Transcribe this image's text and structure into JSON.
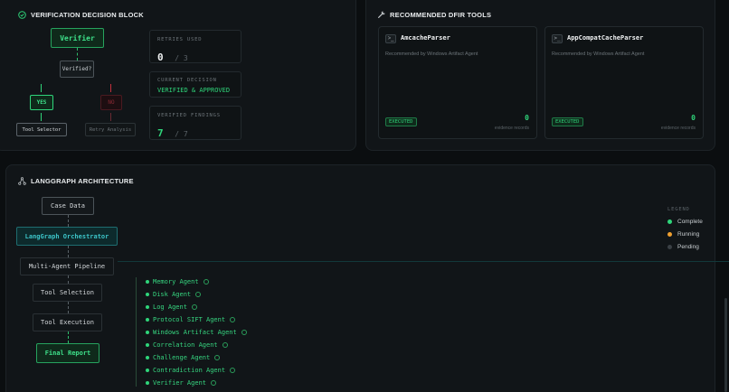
{
  "verification": {
    "title": "VERIFICATION DECISION BLOCK",
    "icon": "check-circle-icon",
    "flow": {
      "verifier": "Verifier",
      "question": "Verified?",
      "yes": "YES",
      "no": "NO",
      "yes_target": "Tool Selector",
      "no_target": "Retry Analysis"
    },
    "stats": {
      "retries_label": "RETRIES USED",
      "retries_value": "0",
      "retries_total": "/ 3",
      "decision_label": "CURRENT DECISION",
      "decision_value": "VERIFIED & APPROVED",
      "findings_label": "VERIFIED FINDINGS",
      "findings_value": "7",
      "findings_total": "/ 7"
    }
  },
  "tools": {
    "title": "RECOMMENDED DFIR TOOLS",
    "icon": "wrench-icon",
    "cards": [
      {
        "name": "AmcacheParser",
        "desc": "Recommended by Windows Artifact Agent",
        "status": "EXECUTED",
        "count": "0",
        "count_label": "evidence records"
      },
      {
        "name": "AppCompatCacheParser",
        "desc": "Recommended by Windows Artifact Agent",
        "status": "EXECUTED",
        "count": "0",
        "count_label": "evidence records"
      }
    ]
  },
  "architecture": {
    "title": "LANGGRAPH ARCHITECTURE",
    "icon": "graph-icon",
    "nodes": {
      "case_data": "Case Data",
      "orchestrator": "LangGraph Orchestrator",
      "pipeline": "Multi-Agent Pipeline",
      "tool_selection": "Tool Selection",
      "tool_execution": "Tool Execution",
      "final_report": "Final Report"
    },
    "agents": [
      "Memory Agent",
      "Disk Agent",
      "Log Agent",
      "Protocol SIFT Agent",
      "Windows Artifact Agent",
      "Correlation Agent",
      "Challenge Agent",
      "Contradiction Agent",
      "Verifier Agent"
    ],
    "legend": {
      "title": "LEGEND",
      "items": [
        {
          "label": "Complete",
          "color": "#2fd57a"
        },
        {
          "label": "Running",
          "color": "#f0a030"
        },
        {
          "label": "Pending",
          "color": "#3a4045"
        }
      ]
    }
  },
  "colors": {
    "accent": "#2fd57a",
    "danger": "#c2303d",
    "panel": "#111518",
    "background": "#0b0e10"
  }
}
